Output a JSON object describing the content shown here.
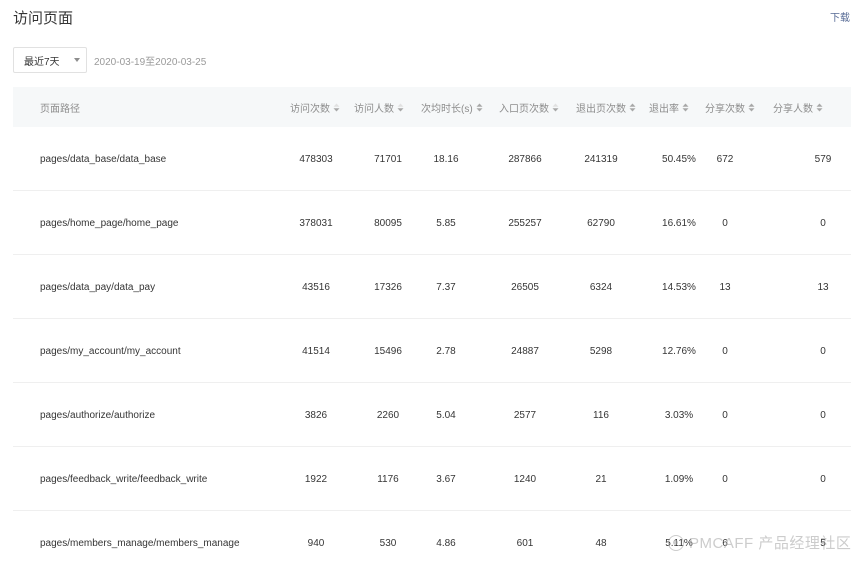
{
  "header": {
    "title": "访问页面",
    "download": "下载"
  },
  "filter": {
    "range_label": "最近7天",
    "date_range": "2020-03-19至2020-03-25"
  },
  "table": {
    "columns": [
      {
        "label": "页面路径",
        "sort": "none"
      },
      {
        "label": "访问次数",
        "sort": "desc"
      },
      {
        "label": "访问人数",
        "sort": "desc"
      },
      {
        "label": "次均时长(s)",
        "sort": "both"
      },
      {
        "label": "入口页次数",
        "sort": "desc"
      },
      {
        "label": "退出页次数",
        "sort": "both"
      },
      {
        "label": "退出率",
        "sort": "both"
      },
      {
        "label": "分享次数",
        "sort": "both"
      },
      {
        "label": "分享人数",
        "sort": "both"
      }
    ],
    "rows": [
      [
        "pages/data_base/data_base",
        "478303",
        "71701",
        "18.16",
        "287866",
        "241319",
        "50.45%",
        "672",
        "579"
      ],
      [
        "pages/home_page/home_page",
        "378031",
        "80095",
        "5.85",
        "255257",
        "62790",
        "16.61%",
        "0",
        "0"
      ],
      [
        "pages/data_pay/data_pay",
        "43516",
        "17326",
        "7.37",
        "26505",
        "6324",
        "14.53%",
        "13",
        "13"
      ],
      [
        "pages/my_account/my_account",
        "41514",
        "15496",
        "2.78",
        "24887",
        "5298",
        "12.76%",
        "0",
        "0"
      ],
      [
        "pages/authorize/authorize",
        "3826",
        "2260",
        "5.04",
        "2577",
        "116",
        "3.03%",
        "0",
        "0"
      ],
      [
        "pages/feedback_write/feedback_write",
        "1922",
        "1176",
        "3.67",
        "1240",
        "21",
        "1.09%",
        "0",
        "0"
      ],
      [
        "pages/members_manage/members_manage",
        "940",
        "530",
        "4.86",
        "601",
        "48",
        "5.11%",
        "6",
        "5"
      ]
    ]
  },
  "watermark": {
    "text": "PMCAFF 产品经理社区"
  }
}
